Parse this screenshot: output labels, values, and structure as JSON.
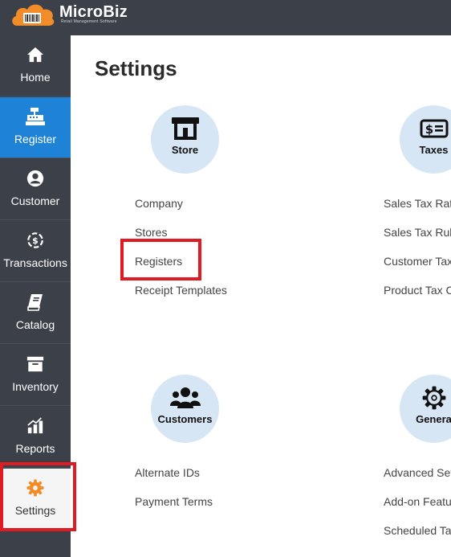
{
  "header": {
    "brand": "MicroBiz",
    "tagline": "Retail Management Software",
    "logo_icon": "barcode-cloud-icon",
    "logo_color": "#f28c28"
  },
  "sidebar": {
    "items": [
      {
        "label": "Home",
        "icon": "home-icon"
      },
      {
        "label": "Register",
        "icon": "cash-register-icon",
        "active": true
      },
      {
        "label": "Customer",
        "icon": "user-circle-icon"
      },
      {
        "label": "Transactions",
        "icon": "dollar-sync-icon"
      },
      {
        "label": "Catalog",
        "icon": "book-icon"
      },
      {
        "label": "Inventory",
        "icon": "archive-box-icon"
      },
      {
        "label": "Reports",
        "icon": "chart-icon"
      },
      {
        "label": "Settings",
        "icon": "gear-icon",
        "selected": true
      }
    ],
    "active_color": "#1e82d6",
    "settings_icon_color": "#f28c28"
  },
  "main": {
    "title": "Settings",
    "sections": {
      "store": {
        "title": "Store",
        "icon": "store-icon",
        "links": [
          "Company",
          "Stores",
          "Registers",
          "Receipt Templates"
        ]
      },
      "taxes": {
        "title": "Taxes",
        "icon": "money-icon",
        "links": [
          "Sales Tax Rat",
          "Sales Tax Rule",
          "Customer Tax",
          "Product Tax C"
        ]
      },
      "customers": {
        "title": "Customers",
        "icon": "users-icon",
        "links": [
          "Alternate IDs",
          "Payment Terms"
        ]
      },
      "general": {
        "title": "Genera",
        "icon": "gear-icon",
        "links": [
          "Advanced Set",
          "Add-on Featu",
          "Scheduled Ta"
        ]
      }
    }
  },
  "highlight_color": "#e01b22"
}
